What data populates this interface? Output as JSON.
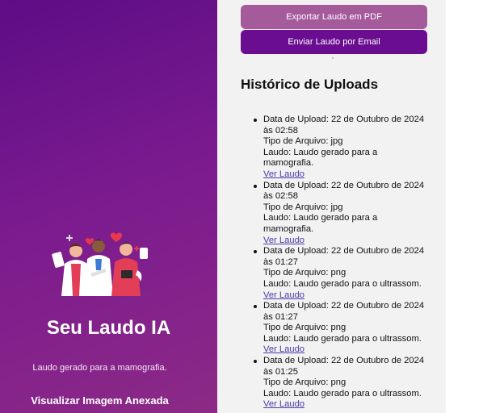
{
  "brand": {
    "title": "Seu Laudo IA",
    "subtitle": "Laudo gerado para a mamografia.",
    "view_image_label": "Visualizar Imagem Anexada"
  },
  "actions": {
    "export_pdf_label": "Exportar Laudo em PDF",
    "send_email_label": "Enviar Laudo por Email"
  },
  "history": {
    "title": "Histórico de Uploads",
    "items": [
      {
        "date": "Data de Upload: 22 de Outubro de 2024 às 02:58",
        "type": "Tipo de Arquivo: jpg",
        "report": "Laudo: Laudo gerado para a mamografia.",
        "link": "Ver Laudo"
      },
      {
        "date": "Data de Upload: 22 de Outubro de 2024 às 02:58",
        "type": "Tipo de Arquivo: jpg",
        "report": "Laudo: Laudo gerado para a mamografia.",
        "link": "Ver Laudo"
      },
      {
        "date": "Data de Upload: 22 de Outubro de 2024 às 01:27",
        "type": "Tipo de Arquivo: png",
        "report": "Laudo: Laudo gerado para o ultrassom.",
        "link": "Ver Laudo"
      },
      {
        "date": "Data de Upload: 22 de Outubro de 2024 às 01:27",
        "type": "Tipo de Arquivo: png",
        "report": "Laudo: Laudo gerado para o ultrassom.",
        "link": "Ver Laudo"
      },
      {
        "date": "Data de Upload: 22 de Outubro de 2024 às 01:25",
        "type": "Tipo de Arquivo: png",
        "report": "Laudo: Laudo gerado para o ultrassom.",
        "link": "Ver Laudo"
      }
    ]
  },
  "colors": {
    "panel_gradient_start": "#5d0d85",
    "panel_gradient_end": "#8c2a86",
    "export_button": "#a55a9b",
    "email_button": "#6a0d91",
    "link": "#4b3aa8"
  }
}
